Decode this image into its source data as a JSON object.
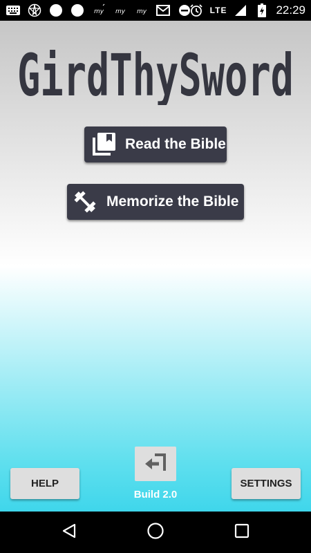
{
  "status_bar": {
    "network": "LTE",
    "time": "22:29",
    "left_icons": [
      "keyboard-icon",
      "pentagram-icon",
      "circle-icon",
      "circle-icon",
      "my-app-icon",
      "my-app-icon",
      "my-app-icon",
      "mail-icon",
      "do-not-disturb-icon"
    ],
    "right_icons": [
      "alarm-icon",
      "lte-signal-icon",
      "battery-charging-icon"
    ]
  },
  "app": {
    "logo_text": "GirdThySword",
    "read_button": {
      "label": "Read the Bible",
      "icon": "book-library-icon"
    },
    "memorize_button": {
      "label": "Memorize the Bible",
      "icon": "dumbbell-icon"
    },
    "help_label": "HELP",
    "settings_label": "SETTINGS",
    "build_label": "Build 2.0",
    "build_icon": "return-arrow-icon"
  },
  "colors": {
    "button_bg": "#3a3b48",
    "gradient_top": "#c6c6c6",
    "gradient_mid": "#ffffff",
    "gradient_bottom": "#3fd6eb"
  },
  "nav_bar": {
    "icons": [
      "back-triangle-icon",
      "home-circle-icon",
      "recents-square-icon"
    ]
  }
}
